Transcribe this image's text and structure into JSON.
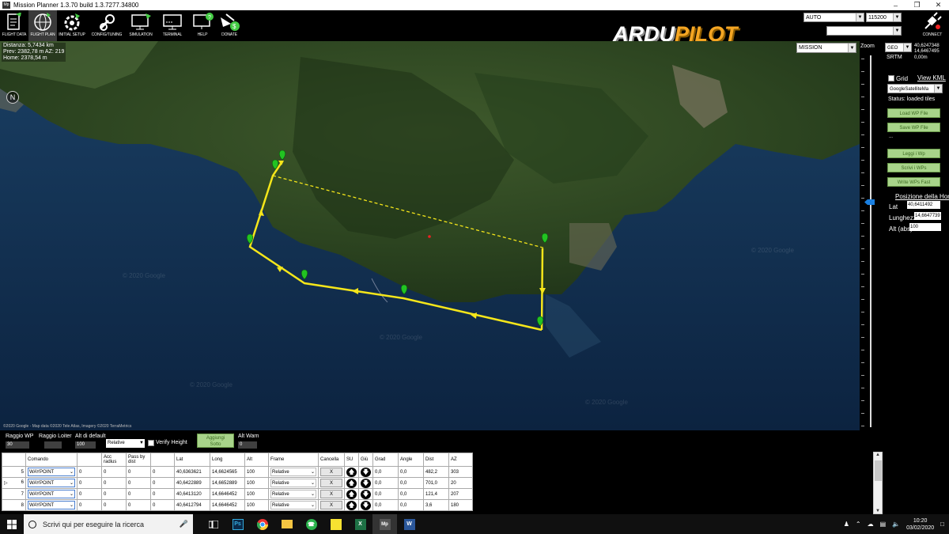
{
  "window": {
    "title": "Mission Planner 1.3.70 build 1.3.7277.34800",
    "app_icon": "Mp"
  },
  "toolbar": {
    "buttons": [
      {
        "label": "FLIGHT DATA",
        "icon": "flight-data-icon"
      },
      {
        "label": "FLIGHT PLAN",
        "icon": "globe-icon"
      },
      {
        "label": "INITIAL SETUP",
        "icon": "setup-icon"
      },
      {
        "label": "CONFIG/TUNING",
        "icon": "wrench-icon"
      },
      {
        "label": "SIMULATION",
        "icon": "monitor-plane-icon"
      },
      {
        "label": "TERMINAL",
        "icon": "terminal-icon"
      },
      {
        "label": "HELP",
        "icon": "help-icon"
      },
      {
        "label": "DONATE",
        "icon": "donate-icon"
      }
    ],
    "logo_ardu": "ARDU",
    "logo_pilot": "PILOT",
    "mode_value": "AUTO",
    "baud_value": "115200",
    "port_value": "",
    "connect_label": "CONNECT"
  },
  "map": {
    "info_line1": "Distanza: 5,7434 km",
    "info_line2": "Prev: 2382,78 m AZ: 219",
    "info_line3": "Home: 2378,54 m",
    "mission_combo": "MISSION",
    "zoom_label": "Zoom",
    "copyright": "©2020 Google - Map data ©2020 Tele Atlas, Imagery ©2020 TerraMetrics",
    "watermark": "© 2020 Google",
    "compass_glyph": "N"
  },
  "right_panel": {
    "coord_system": "GEO",
    "lat": "40,6247348",
    "lng": "14,6467495",
    "srtm_label": "SRTM",
    "srtm_value": "0,00m",
    "grid_label": "Grid",
    "view_kml": "View KML",
    "map_type": "GoogleSatelliteMa",
    "status": "Status: loaded tiles",
    "load_wp": "Load WP File",
    "save_wp": "Save WP File",
    "separator": "...",
    "read_wp": "Leggi i Wp",
    "write_wp": "Scrivi i WPs",
    "write_fast": "Write WPs Fast",
    "home_title": "Posizione della Hom",
    "home_lat_label": "Lat",
    "home_lat": "40,6411492",
    "home_lng_label": "Lunghezza",
    "home_lng": "14,6647739",
    "home_alt_label": "Alt (abs)",
    "home_alt": "100"
  },
  "lower": {
    "raggio_wp_label": "Raggio WP",
    "raggio_wp_value": "30",
    "raggio_loiter_label": "Raggio Loiter",
    "raggio_loiter_value": "",
    "alt_default_label": "Alt di default",
    "alt_default_value": "100",
    "frame_value": "Relative",
    "verify_height": "Verify Height",
    "add_below_line1": "Aggiungi",
    "add_below_line2": "Sotto",
    "alt_warn_label": "Alt Warn",
    "alt_warn_value": "0"
  },
  "table": {
    "headers": [
      "",
      "Comando",
      "",
      "Acc radius",
      "Pass by dist",
      "",
      "Lat",
      "Long",
      "Alt",
      "Frame",
      "Cancella",
      "SU",
      "Giù",
      "Grad",
      "Angle",
      "Dist",
      "AZ"
    ],
    "rows": [
      {
        "num": "5",
        "cmd": "WAYPOINT",
        "p1": "0",
        "p2": "0",
        "p3": "0",
        "p4": "0",
        "lat": "40,6363621",
        "lng": "14,6624565",
        "alt": "100",
        "frame": "Relative",
        "del": "X",
        "grad": "0,0",
        "angle": "0,0",
        "dist": "482,2",
        "az": "303"
      },
      {
        "num": "6",
        "cmd": "WAYPOINT",
        "p1": "0",
        "p2": "0",
        "p3": "0",
        "p4": "0",
        "lat": "40,6422889",
        "lng": "14,6652889",
        "alt": "100",
        "frame": "Relative",
        "del": "X",
        "grad": "0,0",
        "angle": "0,0",
        "dist": "701,0",
        "az": "20"
      },
      {
        "num": "7",
        "cmd": "WAYPOINT",
        "p1": "0",
        "p2": "0",
        "p3": "0",
        "p4": "0",
        "lat": "40,6413120",
        "lng": "14,6646452",
        "alt": "100",
        "frame": "Relative",
        "del": "X",
        "grad": "0,0",
        "angle": "0,0",
        "dist": "121,4",
        "az": "207"
      },
      {
        "num": "8",
        "cmd": "WAYPOINT",
        "p1": "0",
        "p2": "0",
        "p3": "0",
        "p4": "0",
        "lat": "40,6412794",
        "lng": "14,6646452",
        "alt": "100",
        "frame": "Relative",
        "del": "X",
        "grad": "0,0",
        "angle": "0,0",
        "dist": "3,6",
        "az": "180"
      }
    ]
  },
  "taskbar": {
    "search_placeholder": "Scrivi qui per eseguire la ricerca",
    "time": "10:20",
    "date": "03/02/2020"
  },
  "colors": {
    "path": "#f5e61a",
    "marker": "#22c322",
    "accent_btn": "#a8d48a"
  }
}
